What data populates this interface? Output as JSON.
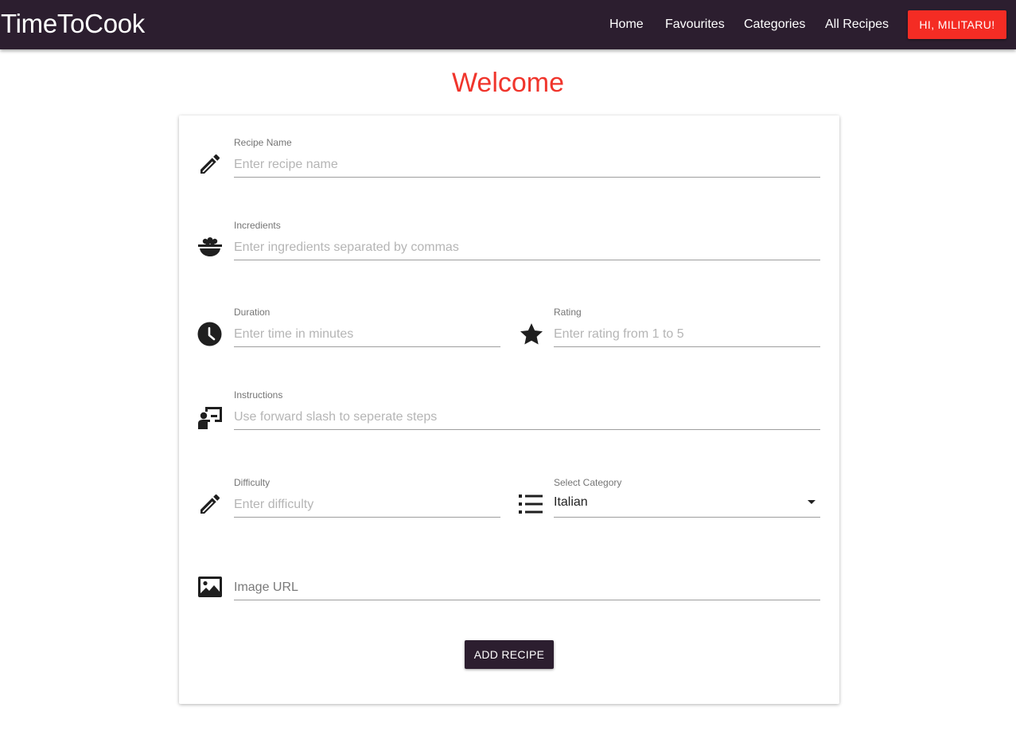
{
  "navbar": {
    "brand": "TimeToCook",
    "links": [
      "Home",
      "Favourites",
      "Categories",
      "All Recipes"
    ],
    "user_button": "HI, MILITARU!"
  },
  "page": {
    "title": "Welcome"
  },
  "form": {
    "recipe_name": {
      "label": "Recipe Name",
      "placeholder": "Enter recipe name",
      "icon": "pencil-icon"
    },
    "ingredients": {
      "label": "Incredients",
      "placeholder": "Enter ingredients separated by commas",
      "icon": "rice-bowl-icon"
    },
    "duration": {
      "label": "Duration",
      "placeholder": "Enter time in minutes",
      "icon": "clock-icon"
    },
    "rating": {
      "label": "Rating",
      "placeholder": "Enter rating from 1 to 5",
      "icon": "star-icon"
    },
    "instructions": {
      "label": "Instructions",
      "placeholder": "Use forward slash to seperate steps",
      "icon": "presentation-icon"
    },
    "difficulty": {
      "label": "Difficulty",
      "placeholder": "Enter difficulty",
      "icon": "pencil-icon"
    },
    "category": {
      "label": "Select Category",
      "value": "Italian",
      "icon": "list-icon"
    },
    "image_url": {
      "placeholder": "Image URL",
      "icon": "image-icon"
    },
    "submit_label": "ADD RECIPE"
  },
  "colors": {
    "navbar": "#2c1e2f",
    "accent": "#f42c24",
    "title": "#f0352c"
  }
}
